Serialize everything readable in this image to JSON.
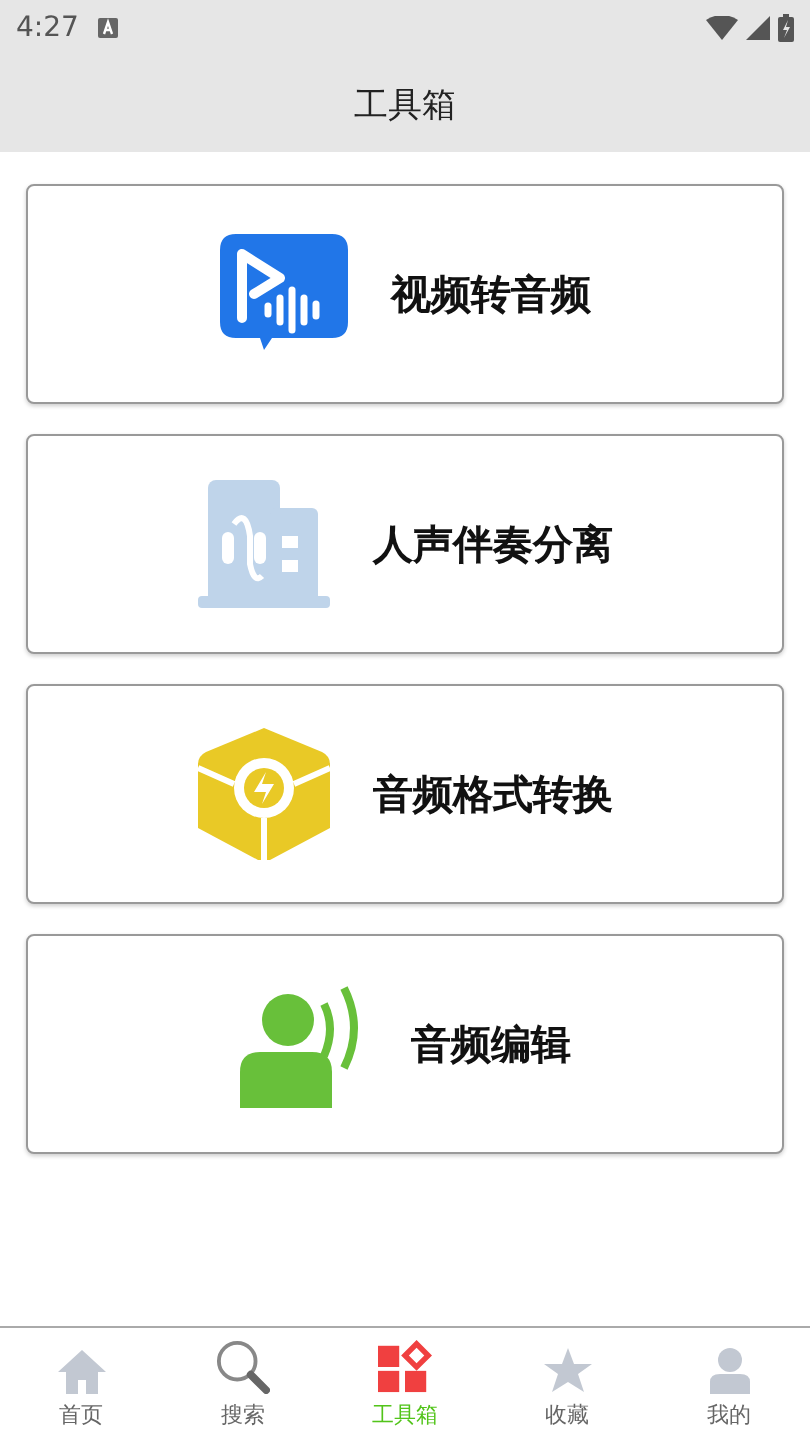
{
  "status_bar": {
    "time": "4:27"
  },
  "header": {
    "title": "工具箱"
  },
  "tools": [
    {
      "kind": "video",
      "label": "视频转音频"
    },
    {
      "kind": "vocal",
      "label": "人声伴奏分离"
    },
    {
      "kind": "format",
      "label": "音频格式转换"
    },
    {
      "kind": "edit",
      "label": "音频编辑"
    }
  ],
  "tabs": [
    {
      "kind": "home",
      "label": "首页",
      "selected": false
    },
    {
      "kind": "search",
      "label": "搜索",
      "selected": false
    },
    {
      "kind": "toolbox",
      "label": "工具箱",
      "selected": true
    },
    {
      "kind": "favorites",
      "label": "收藏",
      "selected": false
    },
    {
      "kind": "profile",
      "label": "我的",
      "selected": false
    }
  ]
}
